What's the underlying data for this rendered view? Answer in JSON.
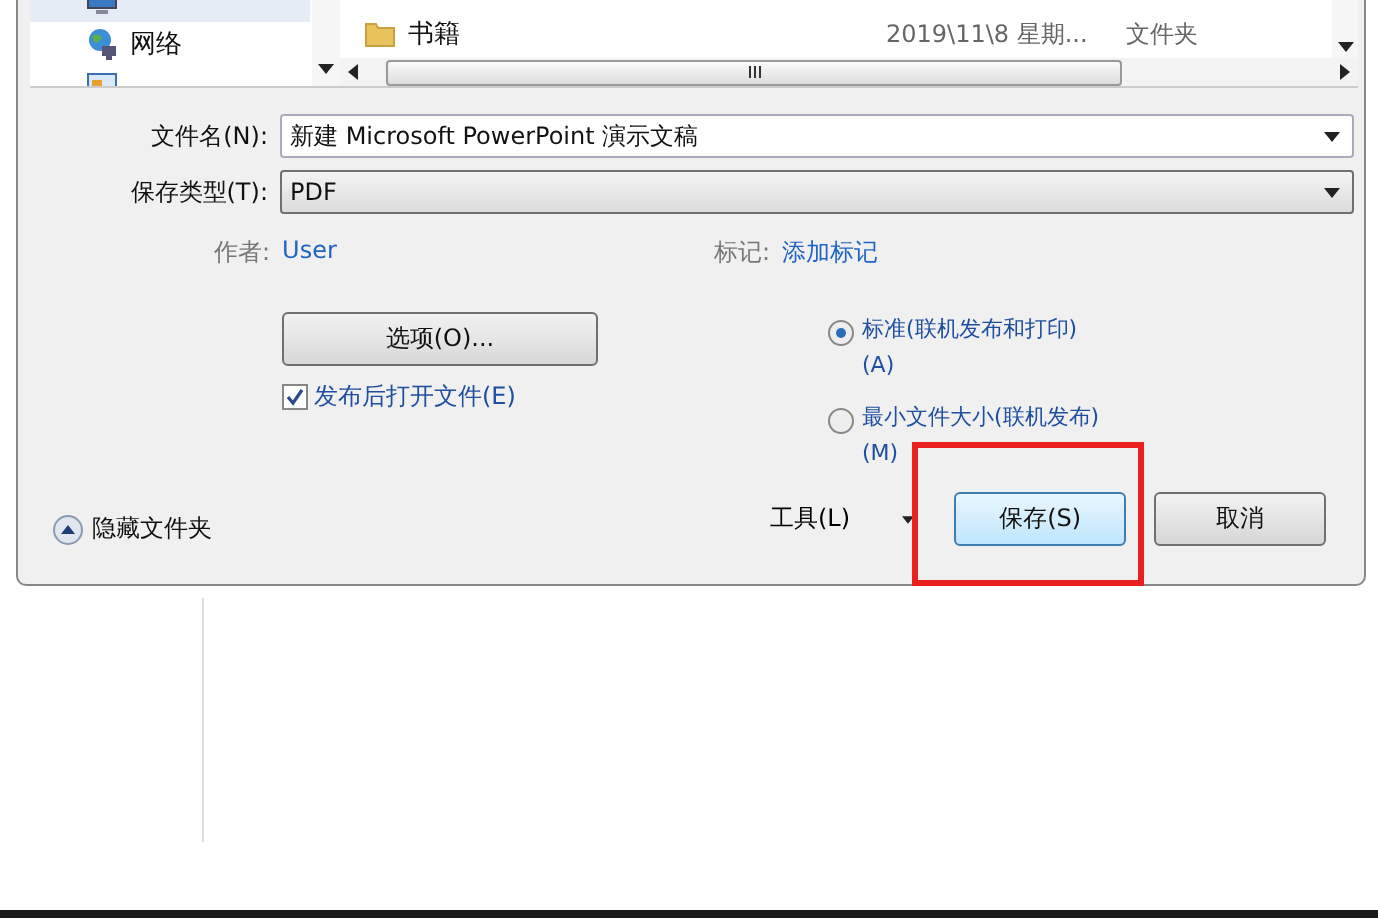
{
  "sidebar": {
    "items": [
      {
        "label": "网络",
        "kind": "network",
        "selected": false
      }
    ]
  },
  "file_list": {
    "rows": [
      {
        "name": "书籍",
        "date": "2019\\11\\8 星期...",
        "type": "文件夹"
      }
    ]
  },
  "fields": [
    {
      "label": "文件名(N):",
      "value": "新建 Microsoft PowerPoint 演示文稿",
      "kind": "combo"
    },
    {
      "label": "保存类型(T):",
      "value": "PDF",
      "kind": "dropdown"
    }
  ],
  "meta": [
    {
      "label": "作者:",
      "value": "User"
    },
    {
      "label": "标记:",
      "value": "添加标记"
    }
  ],
  "options_button": "选项(O)...",
  "open_after": {
    "label": "发布后打开文件(E)",
    "checked": true
  },
  "optimize": [
    {
      "label": "标准(联机发布和打印)(A)",
      "selected": true
    },
    {
      "label": "最小文件大小(联机发布)(M)",
      "selected": false
    }
  ],
  "footer": {
    "hide_folders": "隐藏文件夹",
    "tools": "工具(L)",
    "buttons": [
      {
        "label": "保存(S)",
        "kind": "default",
        "highlighted": true
      },
      {
        "label": "取消",
        "kind": "normal",
        "highlighted": false
      }
    ]
  }
}
